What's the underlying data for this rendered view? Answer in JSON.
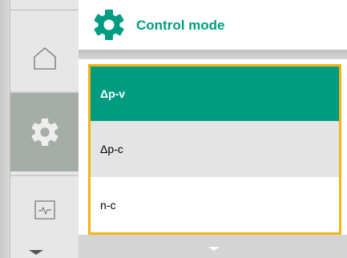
{
  "header": {
    "title": "Control mode",
    "icon": "gear-icon",
    "accent_color": "#009c82"
  },
  "sidebar": {
    "items": [
      {
        "icon": "home-icon",
        "active": false
      },
      {
        "icon": "gear-icon",
        "active": true
      },
      {
        "icon": "monitor-icon",
        "active": false
      }
    ]
  },
  "list": {
    "focus_color": "#f7b515",
    "items": [
      {
        "label": "Δp-v",
        "selected": true
      },
      {
        "label": "Δp-c",
        "selected": false
      },
      {
        "label": "n-c",
        "selected": false
      }
    ]
  }
}
